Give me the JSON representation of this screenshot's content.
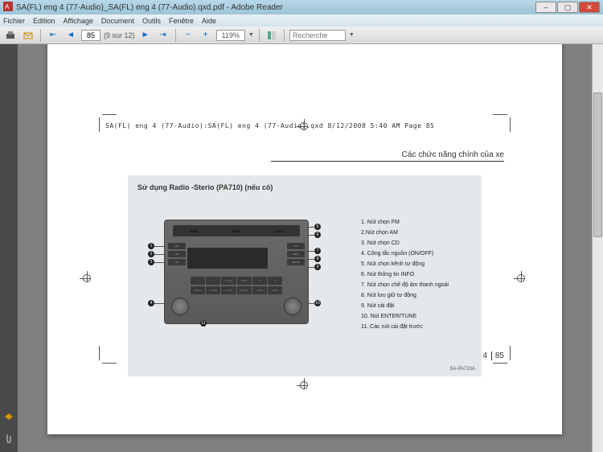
{
  "window": {
    "title": "SA(FL)  eng 4 (77-Audio)_SA(FL)  eng 4 (77-Audio).qxd.pdf - Adobe Reader"
  },
  "menu": {
    "items": [
      "Fichier",
      "Edition",
      "Affichage",
      "Document",
      "Outils",
      "Fenêtre",
      "Aide"
    ]
  },
  "toolbar": {
    "page_current": "85",
    "page_total": "(9 sur 12)",
    "zoom": "119%",
    "search_placeholder": "Recherche"
  },
  "doc": {
    "file_header": "SA(FL)  eng 4 (77-Audio):SA(FL)  eng 4 (77-Audio).qxd  8/12/2008  5:40 AM  Page 85",
    "section_title": "Các chức năng chính của xe",
    "content_title": "Sử dụng Radio -Sterio (PA710) (nếu có)",
    "image_code": "SA-PA710A",
    "legend": [
      "1. Nút chọn FM",
      "2.Nút chọn AM",
      "3. Nút chọn CD",
      "4. Công tắc nguồn (ON/OFF)",
      "5. Nút chọn kênh tự động",
      "6. Nút thông tin INFO",
      "7. Nút chọn chế độ âm thanh ngoài",
      "8. Nút lưu giữ tự động",
      "9. Nút cài đặt",
      "10.  Nút ENTER/TUNE",
      "11. Các nút cài đặt trước"
    ],
    "side_left": [
      "FM",
      "AM",
      "CD"
    ],
    "side_right": [
      "A.S",
      "INFO",
      "SETUP"
    ],
    "presets1": [
      "1",
      "2",
      "3 SHUF",
      "4 RPT",
      "5",
      "6"
    ],
    "presets2": [
      "TRACK",
      "1 DISP",
      "2 INFO",
      "3 SHUF",
      "4 RPT",
      "FLDR"
    ],
    "footer_left": "4",
    "footer_right": "85"
  }
}
